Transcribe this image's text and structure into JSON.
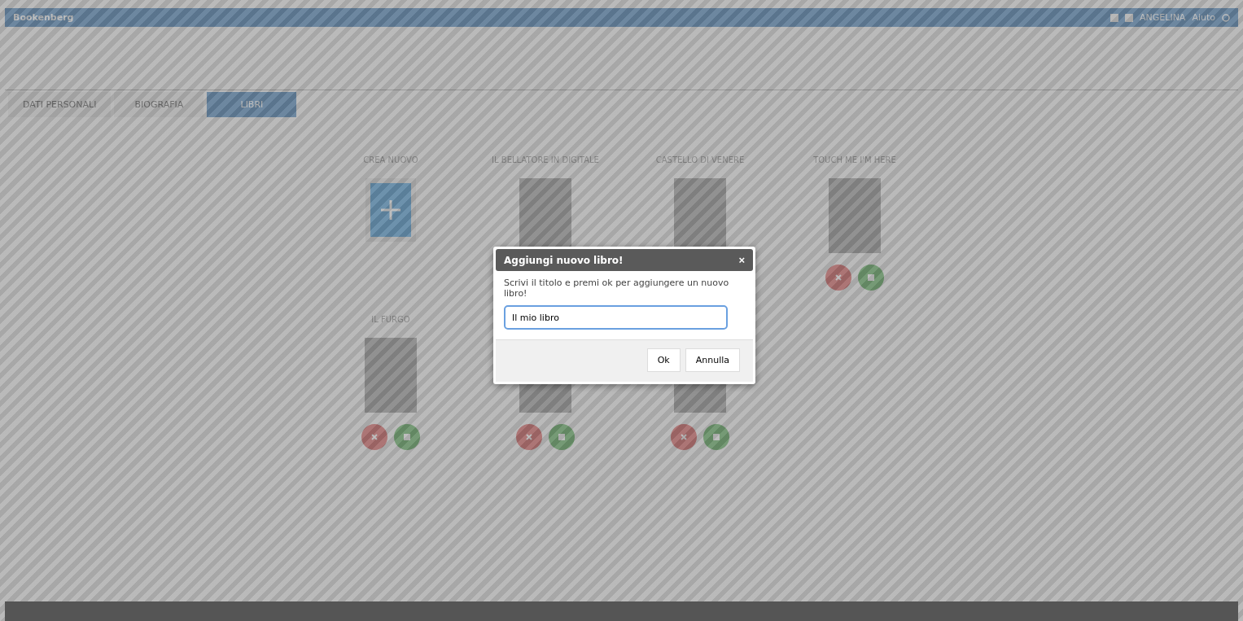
{
  "header": {
    "title": "Bookenberg",
    "user": "ANGELINA",
    "help": "Aiuto"
  },
  "tabs": [
    {
      "label": "DATI PERSONALI",
      "selected": false
    },
    {
      "label": "BIOGRAFIA",
      "selected": false
    },
    {
      "label": "LIBRI",
      "selected": true
    }
  ],
  "books": [
    {
      "kind": "create",
      "title": "CREA NUOVO"
    },
    {
      "kind": "book",
      "title": "IL BELLATORE IN DIGITALE"
    },
    {
      "kind": "book",
      "title": "CASTELLO DI VENERE"
    },
    {
      "kind": "book",
      "title": "TOUCH ME I'M HERE"
    },
    {
      "kind": "book",
      "title": "IL FURGO"
    },
    {
      "kind": "book"
    },
    {
      "kind": "book"
    }
  ],
  "dialog": {
    "title": "Aggiungi nuovo libro!",
    "close": "×",
    "message": "Scrivi il titolo e premi ok per aggiungere un nuovo libro!",
    "value": "Il mio libro",
    "buttons": [
      "Ok",
      "Annulla"
    ]
  }
}
